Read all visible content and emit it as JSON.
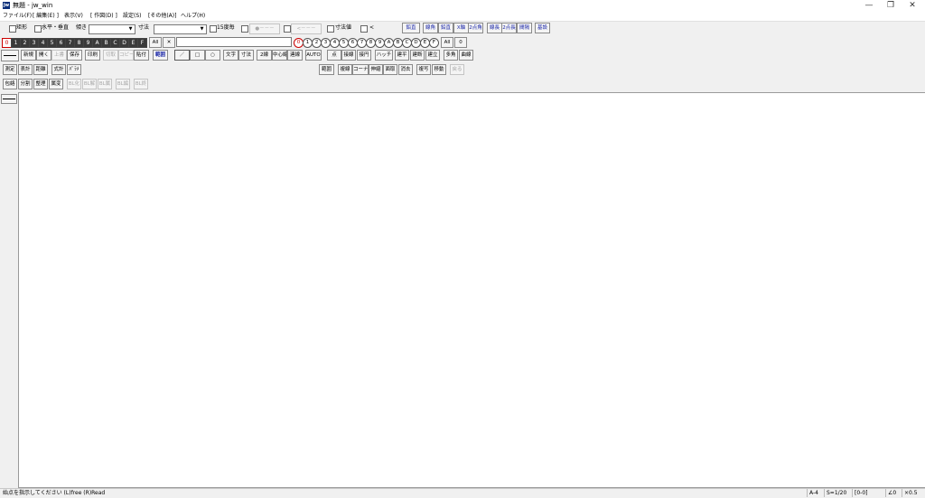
{
  "window": {
    "title": "無題 - jw_win",
    "icon_label": "jw",
    "min_glyph": "—",
    "max_glyph": "❐",
    "close_glyph": "✕"
  },
  "menu": [
    "ファイル(F)",
    "[ 編集(E) ]",
    "表示(V)",
    "[ 作図(D) ]",
    "設定(S)",
    "[その他(A)]",
    "ヘルプ(H)"
  ],
  "options": {
    "rect": "矩形",
    "hv": "水平・垂直",
    "linetype": "傾き",
    "dim": "寸法",
    "deg15": "15度毎",
    "dots1": "●－－－",
    "dots2": "<－－－",
    "dimval": "寸法値",
    "lt": "<"
  },
  "row1_right": [
    "鉛直",
    "線角",
    "鉛直",
    "X軸",
    "2点角",
    "線長",
    "2点長",
    "間隔",
    "基設"
  ],
  "layers": [
    "0",
    "1",
    "2",
    "3",
    "4",
    "5",
    "6",
    "7",
    "8",
    "9",
    "A",
    "B",
    "C",
    "D",
    "E",
    "F"
  ],
  "layers_all": "All",
  "layers_x": "✕",
  "groups": [
    "0",
    "1",
    "2",
    "3",
    "4",
    "5",
    "6",
    "7",
    "8",
    "9",
    "A",
    "B",
    "C",
    "D",
    "E",
    "F"
  ],
  "groups_all": "All",
  "groups_zero": "0",
  "row3": [
    "新規",
    "開く",
    "上書",
    "保存",
    "印刷",
    "切取",
    "コピー",
    "貼付",
    "範囲"
  ],
  "row3_draw": {
    "line": "／",
    "rect": "□",
    "circle": "○",
    "text": "文字",
    "dim": "寸法",
    "double": "2線",
    "center": "中心線",
    "cont": "連線",
    "auto": "AUTO"
  },
  "row3_right": [
    "点",
    "接線",
    "接円",
    "ハッチ",
    "建平",
    "建断",
    "建立",
    "多角",
    "曲線"
  ],
  "row4": [
    "測定",
    "表計",
    "距離",
    "式計",
    "ﾊﾟﾗﾒ"
  ],
  "row4_right": [
    "範囲",
    "複線",
    "コーナー",
    "伸縮",
    "面取",
    "消去",
    "複写",
    "移動",
    "戻る"
  ],
  "row5": [
    "包絡",
    "分割",
    "整理",
    "属変",
    "BL化",
    "BL解",
    "BL属",
    "BL編",
    "BL終"
  ],
  "status": {
    "message": "始点を指示してください (L)free (R)Read",
    "paper": "A-4",
    "scale": "S=1/20",
    "layer": "[0-0]",
    "angle": "∠0",
    "zoom": "×0.5"
  }
}
